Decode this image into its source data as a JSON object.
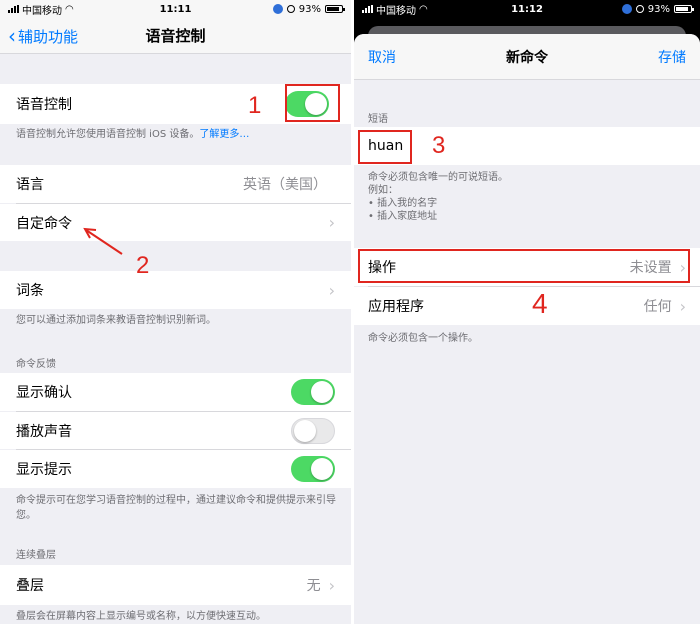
{
  "left": {
    "status": {
      "carrier": "中国移动",
      "time": "11:11",
      "battery": "93%"
    },
    "nav": {
      "back_label": "辅助功能",
      "title": "语音控制"
    },
    "voice_control": {
      "label": "语音控制",
      "on": true
    },
    "voice_control_note": "语音控制允许您使用语音控制 iOS 设备。",
    "voice_control_link": "了解更多…",
    "language": {
      "label": "语言",
      "value": "英语（美国）"
    },
    "custom_commands": {
      "label": "自定命令"
    },
    "vocabulary": {
      "label": "词条",
      "note": "您可以通过添加词条来教语音控制识别新词。"
    },
    "feedback_header": "命令反馈",
    "show_confirmation": {
      "label": "显示确认",
      "on": true
    },
    "play_sound": {
      "label": "播放声音",
      "on": false
    },
    "show_hints": {
      "label": "显示提示",
      "on": true
    },
    "hints_note": "命令提示可在您学习语音控制的过程中，通过建议命令和提供提示来引导您。",
    "overlay_header": "连续叠层",
    "overlay": {
      "label": "叠层",
      "value": "无"
    },
    "overlay_note": "叠层会在屏幕内容上显示编号或名称，以方便快速互动。"
  },
  "right": {
    "status": {
      "carrier": "中国移动",
      "time": "11:12",
      "battery": "93%"
    },
    "nav": {
      "cancel_label": "取消",
      "title": "新命令",
      "save_label": "存储"
    },
    "phrase_header": "短语",
    "phrase_value": "huan",
    "phrase_note_1": "命令必须包含唯一的可说短语。",
    "phrase_note_2": "例如：",
    "phrase_note_3": "• 插入我的名字",
    "phrase_note_4": "• 插入家庭地址",
    "action": {
      "label": "操作",
      "value": "未设置"
    },
    "application": {
      "label": "应用程序",
      "value": "任何"
    },
    "action_note": "命令必须包含一个操作。"
  },
  "annotations": [
    "1",
    "2",
    "3",
    "4"
  ],
  "colors": {
    "accent": "#007aff",
    "toggle_on": "#4cd964",
    "annotation_red": "#e0261f"
  }
}
